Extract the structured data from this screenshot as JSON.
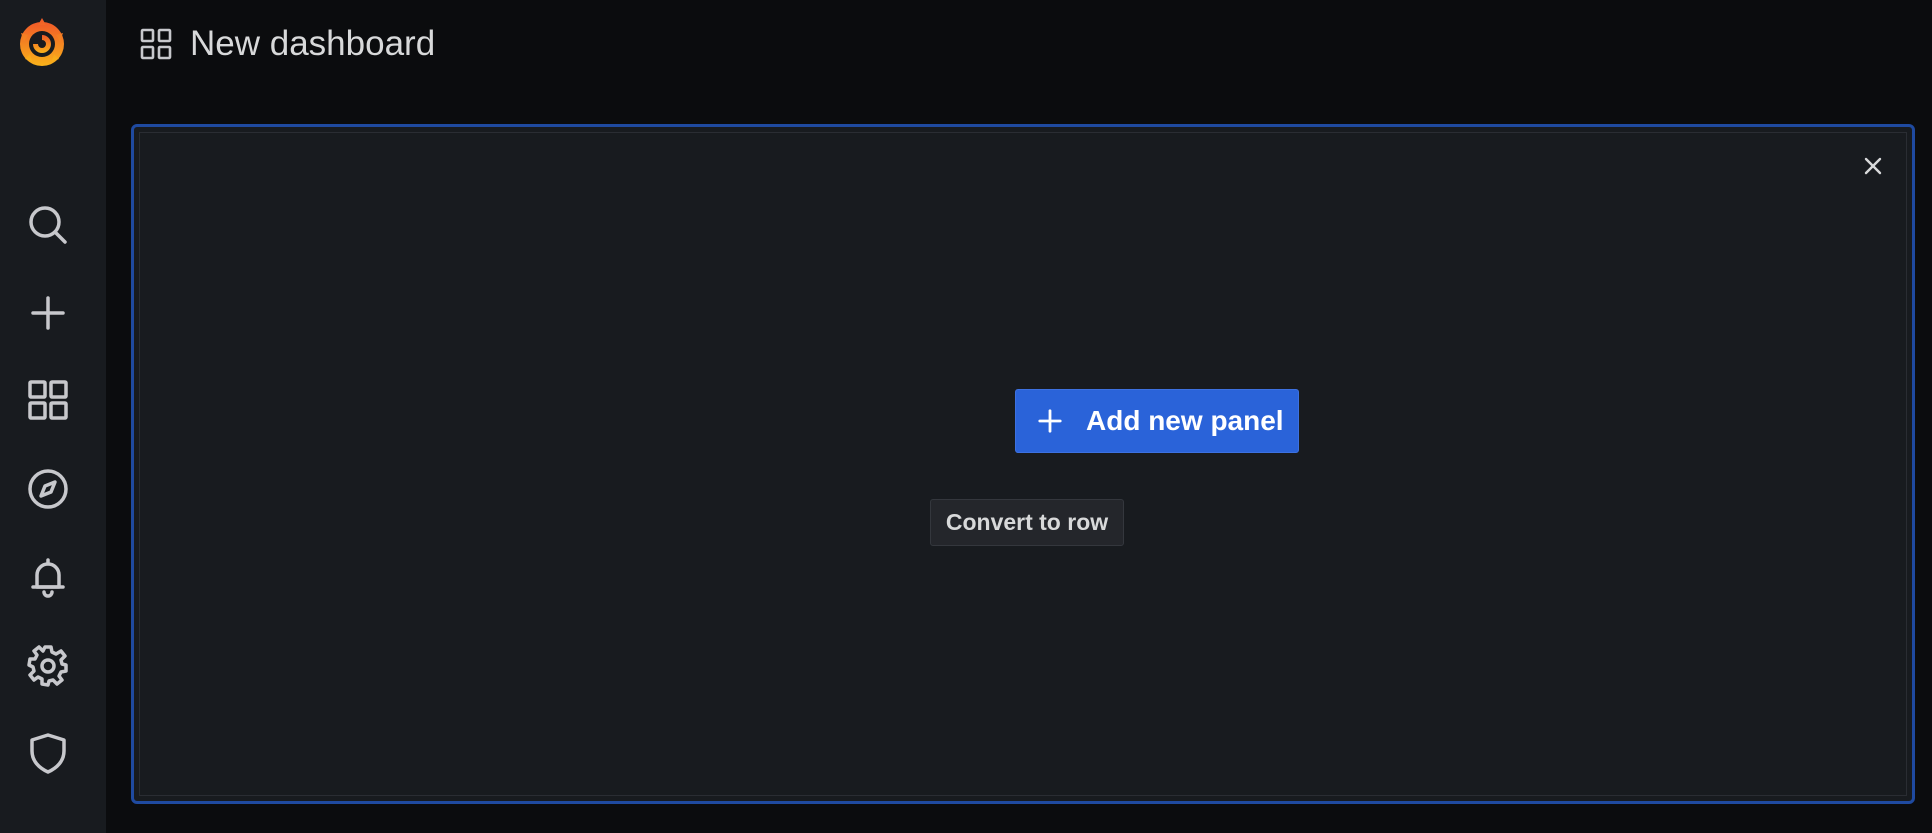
{
  "app": {
    "logo_icon": "grafana-logo-icon"
  },
  "sidebar": {
    "items": [
      {
        "name": "search",
        "icon": "search-icon"
      },
      {
        "name": "create",
        "icon": "plus-icon"
      },
      {
        "name": "dashboards",
        "icon": "grid-icon"
      },
      {
        "name": "explore",
        "icon": "compass-icon"
      },
      {
        "name": "alerting",
        "icon": "bell-icon"
      },
      {
        "name": "configuration",
        "icon": "gear-icon"
      },
      {
        "name": "server-admin",
        "icon": "shield-icon"
      }
    ]
  },
  "header": {
    "title": "New dashboard",
    "icon": "apps-grid-icon"
  },
  "panel": {
    "add_new_panel_label": "Add new panel",
    "convert_to_row_label": "Convert to row",
    "close_icon": "close-icon"
  },
  "colors": {
    "accent": "#2a63d9",
    "panel_border": "#1f4aa0",
    "background": "#0b0c0e",
    "sidebar": "#181b1f"
  }
}
